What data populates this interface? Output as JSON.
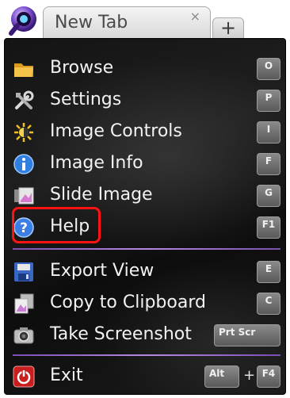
{
  "tab": {
    "title": "New Tab",
    "close": "×",
    "new_tab": "+"
  },
  "menu": {
    "items": [
      {
        "label": "Browse",
        "key": "O",
        "icon": "folder-icon"
      },
      {
        "label": "Settings",
        "key": "P",
        "icon": "tools-icon"
      },
      {
        "label": "Image Controls",
        "key": "I",
        "icon": "brightness-icon"
      },
      {
        "label": "Image Info",
        "key": "F",
        "icon": "info-icon"
      },
      {
        "label": "Slide Image",
        "key": "G",
        "icon": "slide-icon"
      },
      {
        "label": "Help",
        "key": "F1",
        "icon": "help-icon"
      },
      {
        "label": "Export View",
        "key": "E",
        "icon": "save-icon"
      },
      {
        "label": "Copy to Clipboard",
        "key": "C",
        "icon": "copy-icon"
      },
      {
        "label": "Take Screenshot",
        "key": "Prt Scr",
        "icon": "camera-icon"
      },
      {
        "label": "Exit",
        "key_mod": "Alt",
        "key_plus": "+",
        "key": "F4",
        "icon": "power-icon"
      }
    ]
  },
  "colors": {
    "highlight": "#ff1212",
    "divider": "#b48ae0",
    "menu_bg": "#141414"
  }
}
